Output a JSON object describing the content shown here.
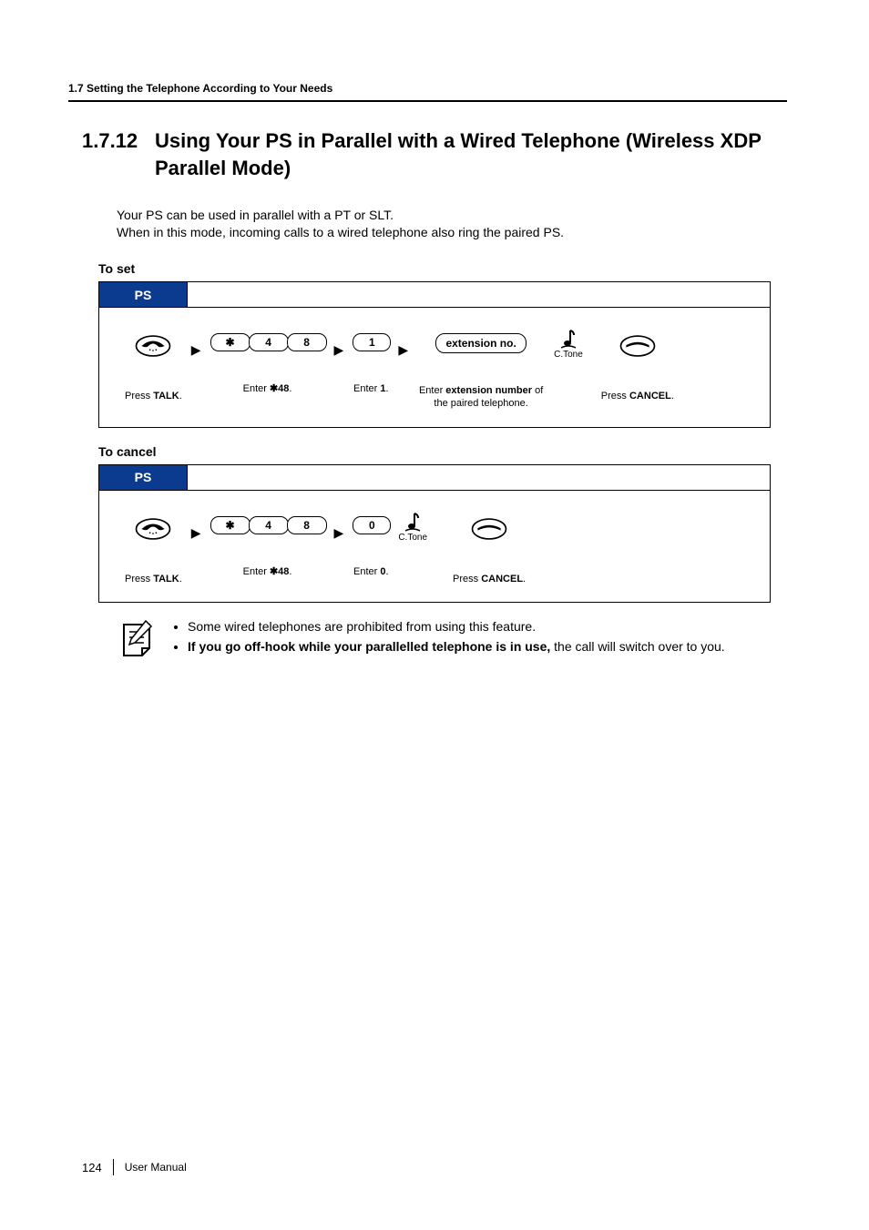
{
  "header": {
    "running": "1.7 Setting the Telephone According to Your Needs"
  },
  "title": {
    "number": "1.7.12",
    "text": "Using Your PS in Parallel with a Wired Telephone (Wireless XDP Parallel Mode)"
  },
  "intro": {
    "line1": "Your PS can be used in parallel with a PT or SLT.",
    "line2": "When in this mode, incoming calls to a wired telephone also ring the paired PS."
  },
  "set": {
    "heading": "To set",
    "tab": "PS",
    "keys": {
      "star": "✱",
      "k4": "4",
      "k8": "8",
      "k1": "1"
    },
    "chip": "extension no.",
    "ctone": "C.Tone",
    "captions": {
      "talk_pre": "Press ",
      "talk_bold": "TALK",
      "talk_post": ".",
      "enter48_pre": "Enter ",
      "enter48_bold": "✱48",
      "enter48_post": ".",
      "enter1_pre": "Enter ",
      "enter1_bold": "1",
      "enter1_post": ".",
      "ext_pre": "Enter ",
      "ext_bold": "extension number",
      "ext_post": " of the paired telephone.",
      "cancel_pre": "Press ",
      "cancel_bold": "CANCEL",
      "cancel_post": "."
    }
  },
  "cancel": {
    "heading": "To cancel",
    "tab": "PS",
    "keys": {
      "star": "✱",
      "k4": "4",
      "k8": "8",
      "k0": "0"
    },
    "ctone": "C.Tone",
    "captions": {
      "talk_pre": "Press ",
      "talk_bold": "TALK",
      "talk_post": ".",
      "enter48_pre": "Enter ",
      "enter48_bold": "✱48",
      "enter48_post": ".",
      "enter0_pre": "Enter ",
      "enter0_bold": "0",
      "enter0_post": ".",
      "cancel_pre": "Press ",
      "cancel_bold": "CANCEL",
      "cancel_post": "."
    }
  },
  "notes": {
    "n1": "Some wired telephones are prohibited from using this feature.",
    "n2_bold": "If you go off-hook while your parallelled telephone is in use,",
    "n2_rest": " the call will switch over to you."
  },
  "footer": {
    "page": "124",
    "doc": "User Manual"
  }
}
